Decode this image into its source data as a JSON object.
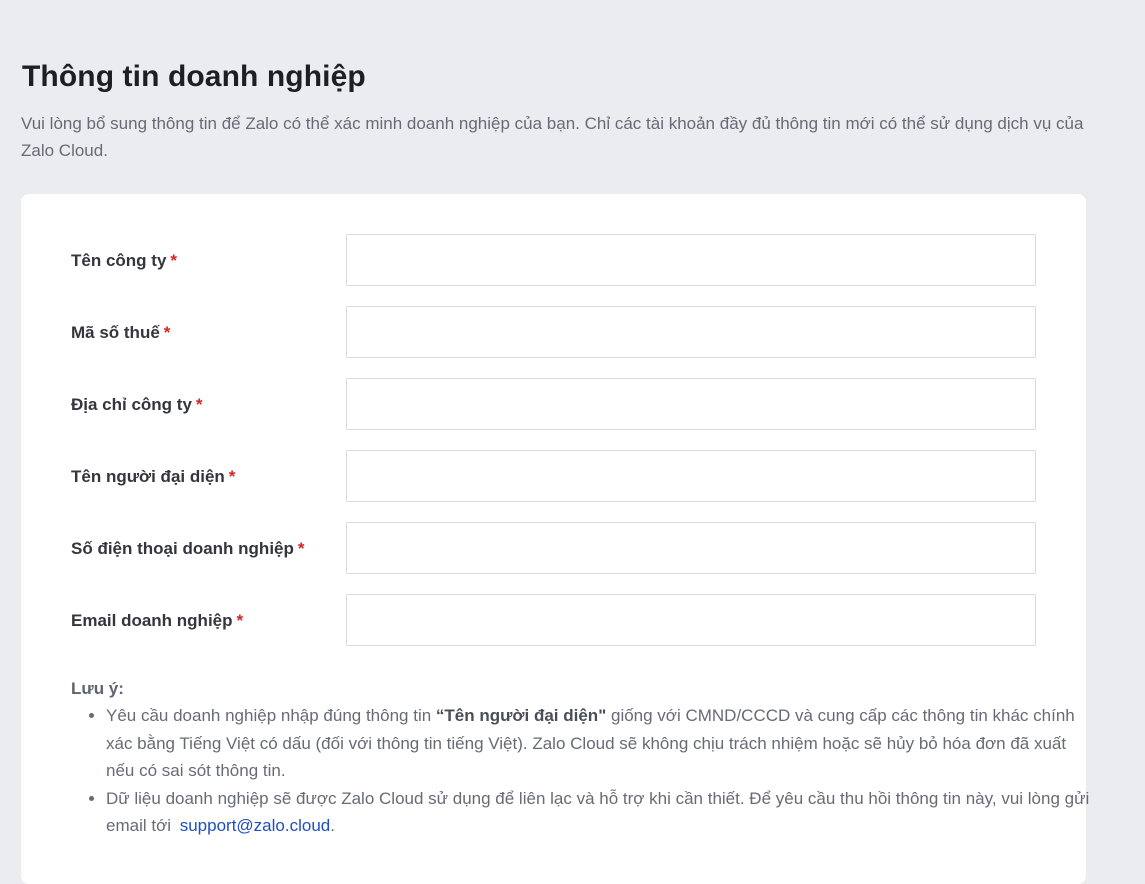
{
  "page": {
    "title": "Thông tin doanh nghiệp",
    "description": "Vui lòng bổ sung thông tin để Zalo có thể xác minh doanh nghiệp của bạn. Chỉ các tài khoản đầy đủ thông tin mới có thể sử dụng dịch vụ của Zalo Cloud."
  },
  "form": {
    "required_mark": "*",
    "fields": [
      {
        "label": "Tên công ty",
        "value": "",
        "placeholder": ""
      },
      {
        "label": "Mã số thuế",
        "value": "",
        "placeholder": ""
      },
      {
        "label": "Địa chỉ công ty",
        "value": "",
        "placeholder": ""
      },
      {
        "label": "Tên người đại diện",
        "value": "",
        "placeholder": ""
      },
      {
        "label": "Số điện thoại doanh nghiệp",
        "value": "",
        "placeholder": ""
      },
      {
        "label": "Email doanh nghiệp",
        "value": "",
        "placeholder": ""
      }
    ]
  },
  "notes": {
    "title": "Lưu ý:",
    "item1_before": "Yêu cầu doanh nghiệp nhập đúng thông tin ",
    "item1_bold": "“Tên người đại diện\"",
    "item1_after": " giống với CMND/CCCD và cung cấp các thông tin khác chính xác bằng Tiếng Việt có dấu (đối với thông tin tiếng Việt). Zalo Cloud sẽ không chịu trách nhiệm hoặc sẽ hủy bỏ hóa đơn đã xuất nếu có sai sót thông tin.",
    "item2_text": "Dữ liệu doanh nghiệp sẽ được Zalo Cloud sử dụng để liên lạc và hỗ trợ khi cần thiết. Để yêu cầu thu hồi thông tin này, vui lòng gửi email tới ",
    "support_email": "support@zalo.cloud",
    "item2_end": "."
  },
  "colors": {
    "background": "#ebecf0",
    "card": "#ffffff",
    "required": "#d42525",
    "link": "#1f4fc4"
  }
}
